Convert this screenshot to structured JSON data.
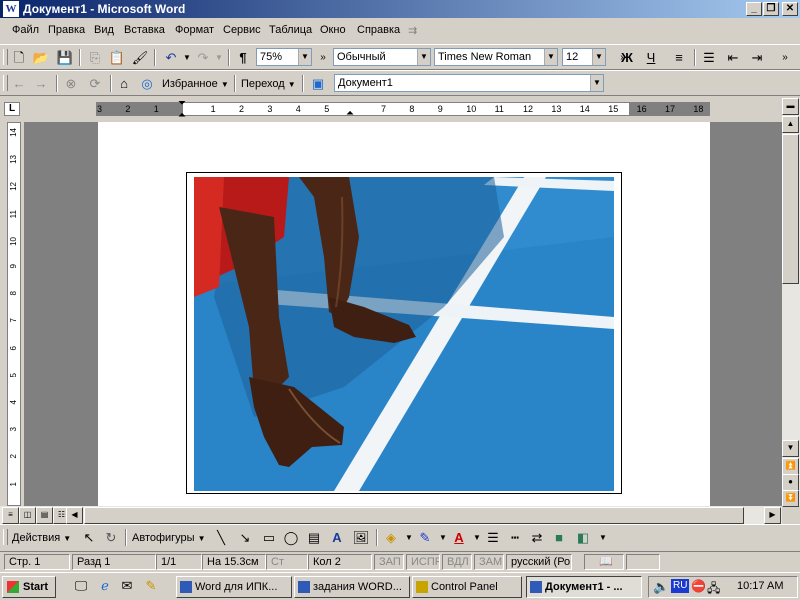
{
  "window": {
    "title": "Документ1 - Microsoft Word",
    "app_icon": "W"
  },
  "menu": [
    "Файл",
    "Правка",
    "Вид",
    "Вставка",
    "Формат",
    "Сервис",
    "Таблица",
    "Окно",
    "Справка"
  ],
  "standard_toolbar": {
    "zoom": "75%",
    "style": "Обычный",
    "font": "Times New Roman",
    "size": "12",
    "bold": "Ж",
    "underline": "Ч"
  },
  "web_toolbar": {
    "favorites": "Избранное",
    "go": "Переход",
    "address": "Документ1"
  },
  "ruler_numbers": [
    "3",
    "2",
    "1",
    "1",
    "2",
    "3",
    "4",
    "5",
    "7",
    "8",
    "9",
    "10",
    "11",
    "12",
    "13",
    "14",
    "15",
    "16",
    "17",
    "18"
  ],
  "vruler_numbers": [
    "14",
    "13",
    "12",
    "11",
    "10",
    "9",
    "8",
    "7",
    "6",
    "5",
    "4",
    "3",
    "2",
    "1"
  ],
  "drawing_toolbar": {
    "actions": "Действия",
    "autoshapes": "Автофигуры"
  },
  "status": {
    "page": "Стр. 1",
    "section": "Разд 1",
    "pages": "1/1",
    "at": "На 15.3см",
    "line": "Ст",
    "col": "Кол 2",
    "rec": "ЗАП",
    "trk": "ИСПР",
    "ext": "ВДЛ",
    "ovr": "ЗАМ",
    "lang": "русский (Ро"
  },
  "taskbar": {
    "start": "Start",
    "items": [
      {
        "label": "Word для ИПК..."
      },
      {
        "label": "задания WORD..."
      },
      {
        "label": "Control Panel"
      },
      {
        "label": "Документ1 - ..."
      }
    ],
    "lang": "RU",
    "clock": "10:17 AM"
  },
  "colors": {
    "track_blue": "#2a85c8",
    "title_blue": "#0a246a"
  }
}
